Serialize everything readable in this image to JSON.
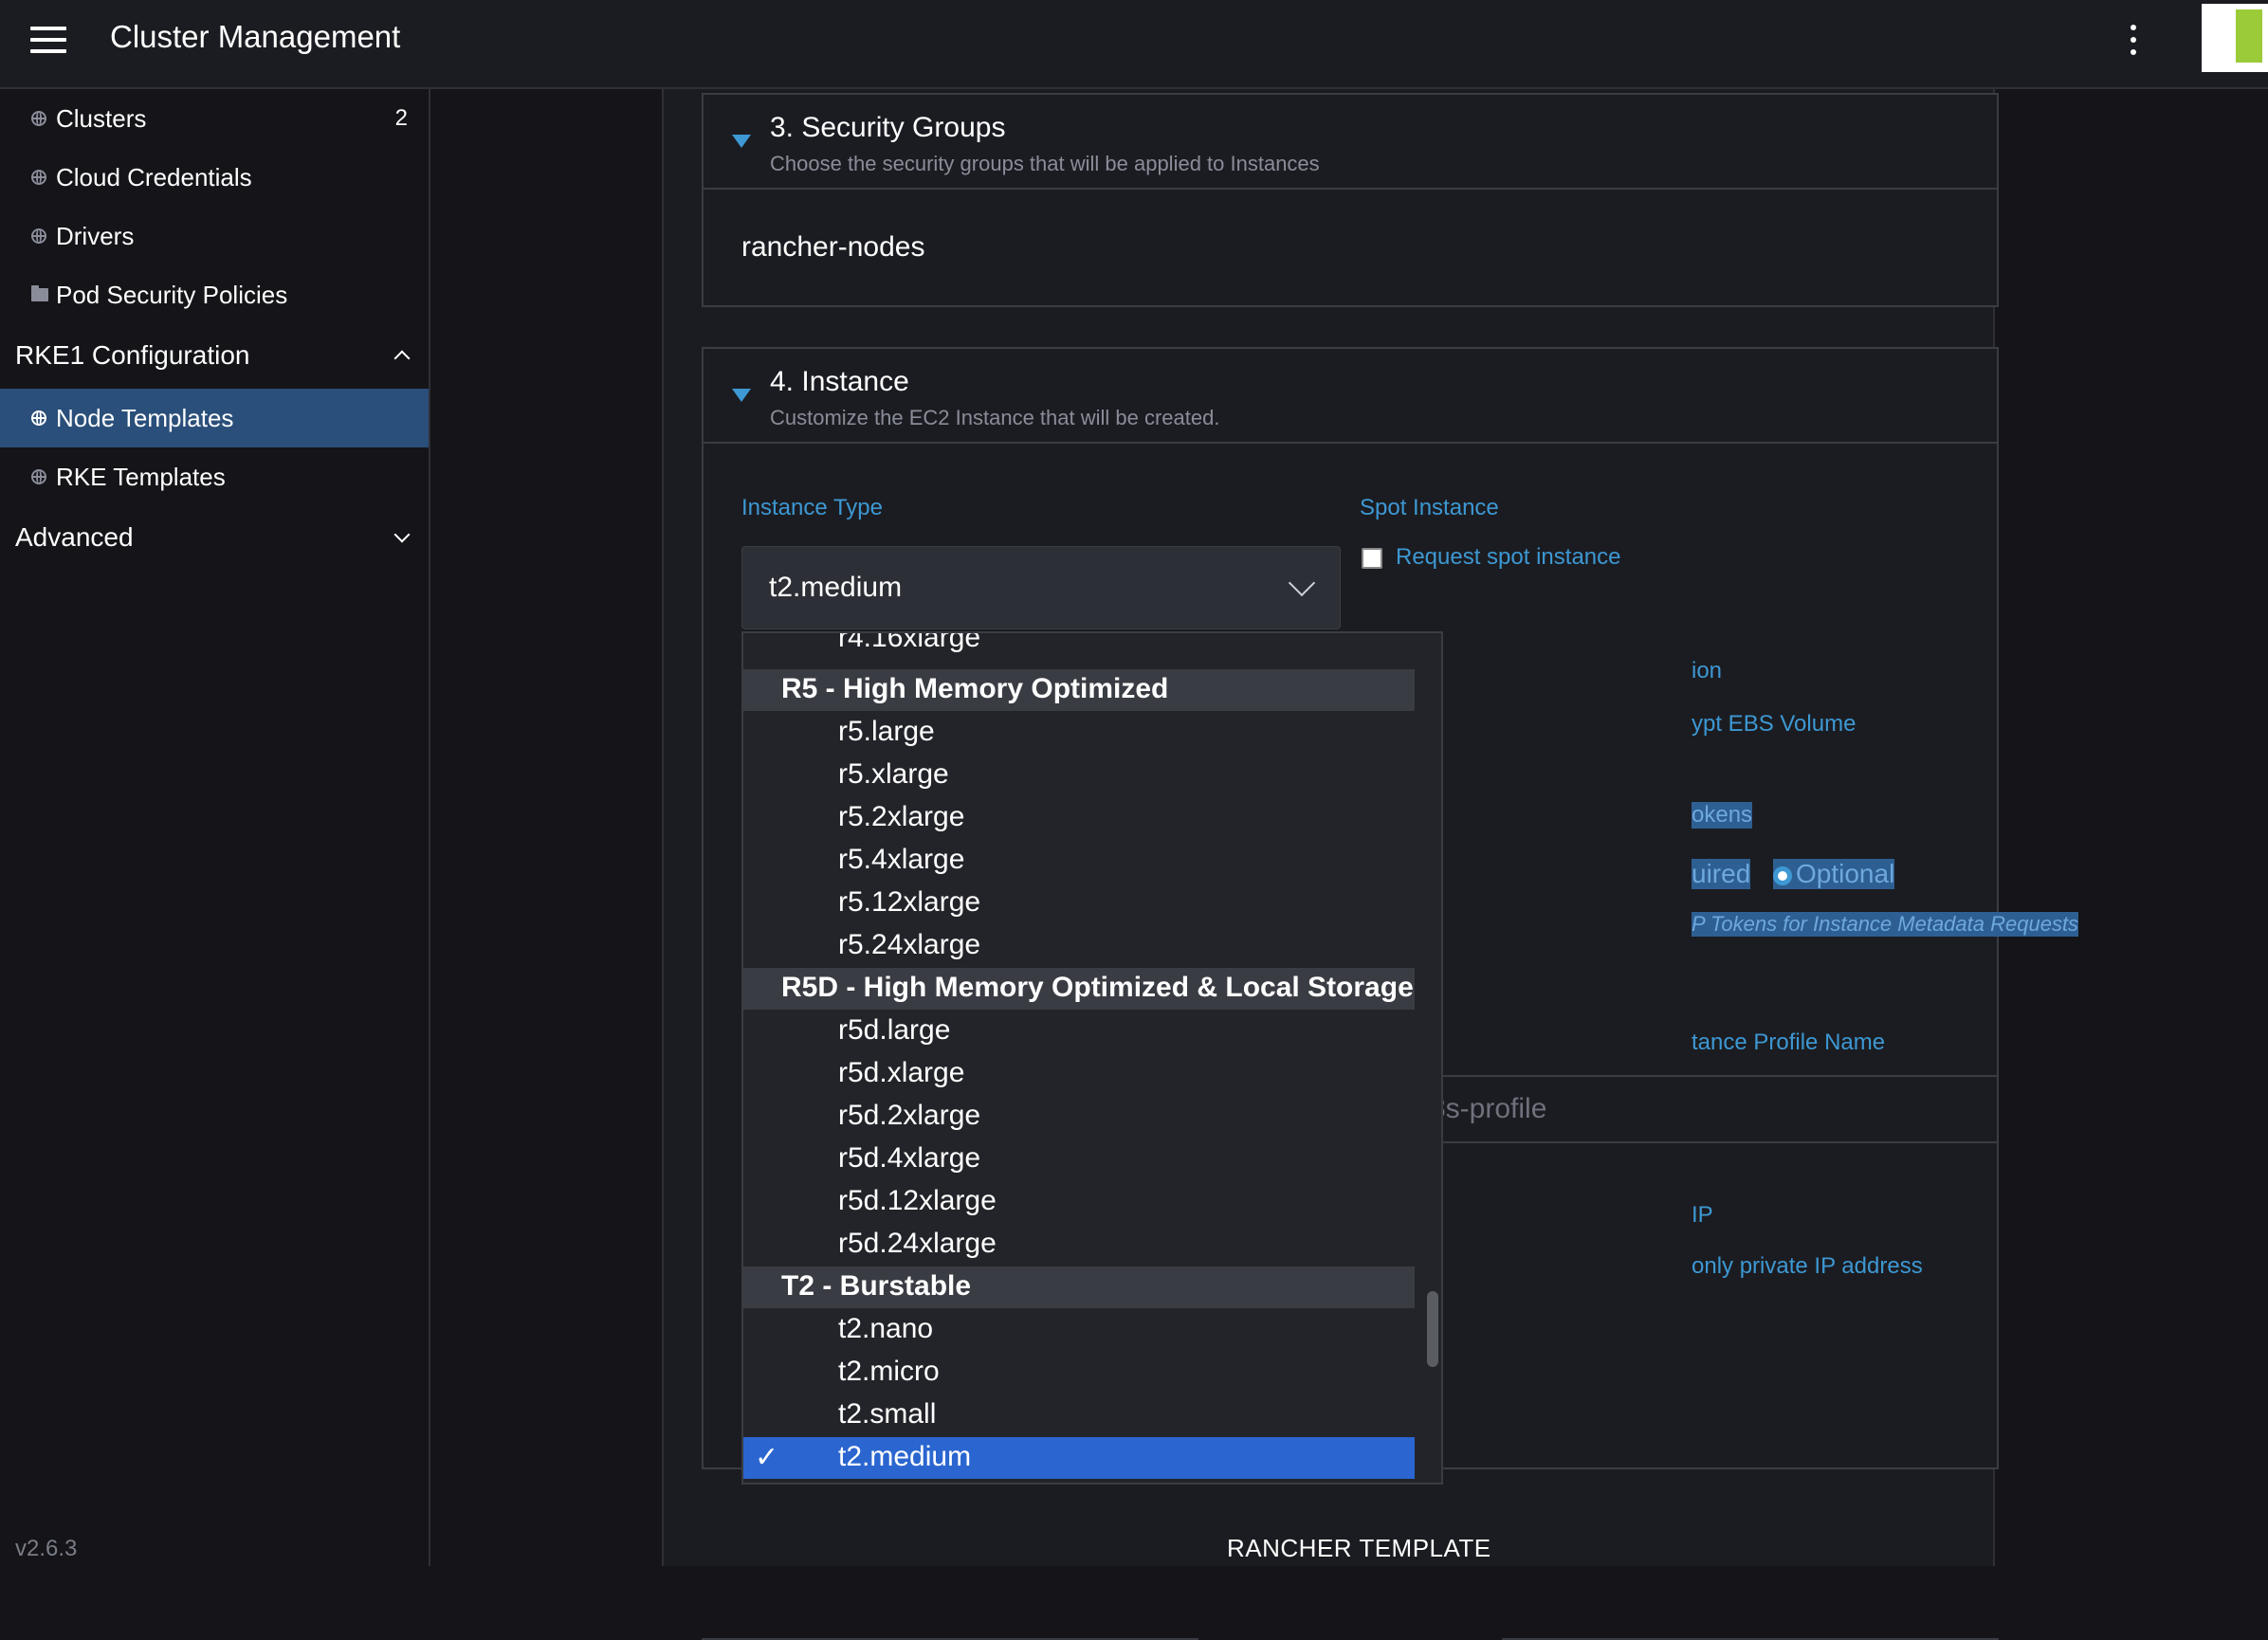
{
  "header": {
    "title": "Cluster Management"
  },
  "sidebar": {
    "items": [
      {
        "label": "Clusters",
        "count": "2"
      },
      {
        "label": "Cloud Credentials"
      },
      {
        "label": "Drivers"
      },
      {
        "label": "Pod Security Policies"
      }
    ],
    "group_rke1": {
      "label": "RKE1 Configuration",
      "items": [
        {
          "label": "Node Templates"
        },
        {
          "label": "RKE Templates"
        }
      ]
    },
    "group_advanced": {
      "label": "Advanced"
    },
    "version": "v2.6.3"
  },
  "security_groups": {
    "title": "3. Security Groups",
    "subtitle": "Choose the security groups that will be applied to Instances",
    "value": "rancher-nodes"
  },
  "instance": {
    "title": "4. Instance",
    "subtitle": "Customize the EC2 Instance that will be created.",
    "instance_type_label": "Instance Type",
    "instance_type_value": "t2.medium",
    "spot_label": "Spot Instance",
    "spot_checkbox_label": "Request spot instance",
    "partial": {
      "encryption_label": "ion",
      "encrypt_ebs_label": "ypt EBS Volume",
      "tokens_label": "okens",
      "required_label": "uired",
      "optional_label": "Optional",
      "http_tokens_text": "P Tokens for Instance Metadata Requests",
      "profile_label": "tance Profile Name",
      "profile_placeholder": "8s-profile",
      "ip_label": "IP",
      "private_ip_label": "only private IP address"
    }
  },
  "dropdown": {
    "partial_top": "r4.16xlarge",
    "groups": [
      {
        "label": "R5 - High Memory Optimized",
        "items": [
          "r5.large",
          "r5.xlarge",
          "r5.2xlarge",
          "r5.4xlarge",
          "r5.12xlarge",
          "r5.24xlarge"
        ]
      },
      {
        "label": "R5D - High Memory Optimized & Local Storage",
        "items": [
          "r5d.large",
          "r5d.xlarge",
          "r5d.2xlarge",
          "r5d.4xlarge",
          "r5d.12xlarge",
          "r5d.24xlarge"
        ]
      },
      {
        "label": "T2 - Burstable",
        "items": [
          "t2.nano",
          "t2.micro",
          "t2.small",
          "t2.medium"
        ]
      }
    ],
    "selected": "t2.medium",
    "check_glyph": "✓"
  },
  "footer": {
    "rancher_template_label": "RANCHER TEMPLATE"
  },
  "colors": {
    "accent": "#3d98d3",
    "active_nav": "#2a4f7a",
    "selected_option": "#2b66d0",
    "avatar_green": "#9ccb3a"
  }
}
